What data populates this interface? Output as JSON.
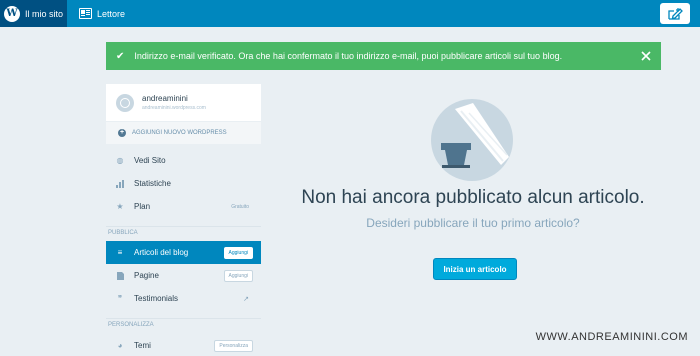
{
  "topbar": {
    "my_site": "Il mio sito",
    "reader": "Lettore"
  },
  "notice": {
    "text": "Indirizzo e-mail verificato. Ora che hai confermato il tuo indirizzo e-mail, puoi pubblicare articoli sul tuo blog."
  },
  "site": {
    "name": "andreaminini",
    "url": "andreaminini.wordpress.com",
    "add_wordpress": "AGGIUNGI NUOVO WORDPRESS"
  },
  "menu": {
    "view_site": "Vedi Sito",
    "stats": "Statistiche",
    "plan": "Plan",
    "plan_tag": "Gratuito",
    "publish_section": "PUBBLICA",
    "blog_posts": "Articoli del blog",
    "blog_posts_add": "Aggiungi",
    "pages": "Pagine",
    "pages_add": "Aggiungi",
    "testimonials": "Testimonials",
    "personalize_section": "PERSONALIZZA",
    "themes": "Temi",
    "themes_tag": "Personalizza"
  },
  "main": {
    "title": "Non hai ancora pubblicato alcun articolo.",
    "subtitle": "Desideri pubblicare il tuo primo articolo?",
    "cta": "Inizia un articolo"
  },
  "watermark": "WWW.ANDREAMININI.COM",
  "colors": {
    "topbar": "#0087be",
    "topbar_active": "#005082",
    "notice": "#4ab866",
    "active_item": "#0087be",
    "cta": "#00aadc",
    "background": "#e9eff3"
  }
}
